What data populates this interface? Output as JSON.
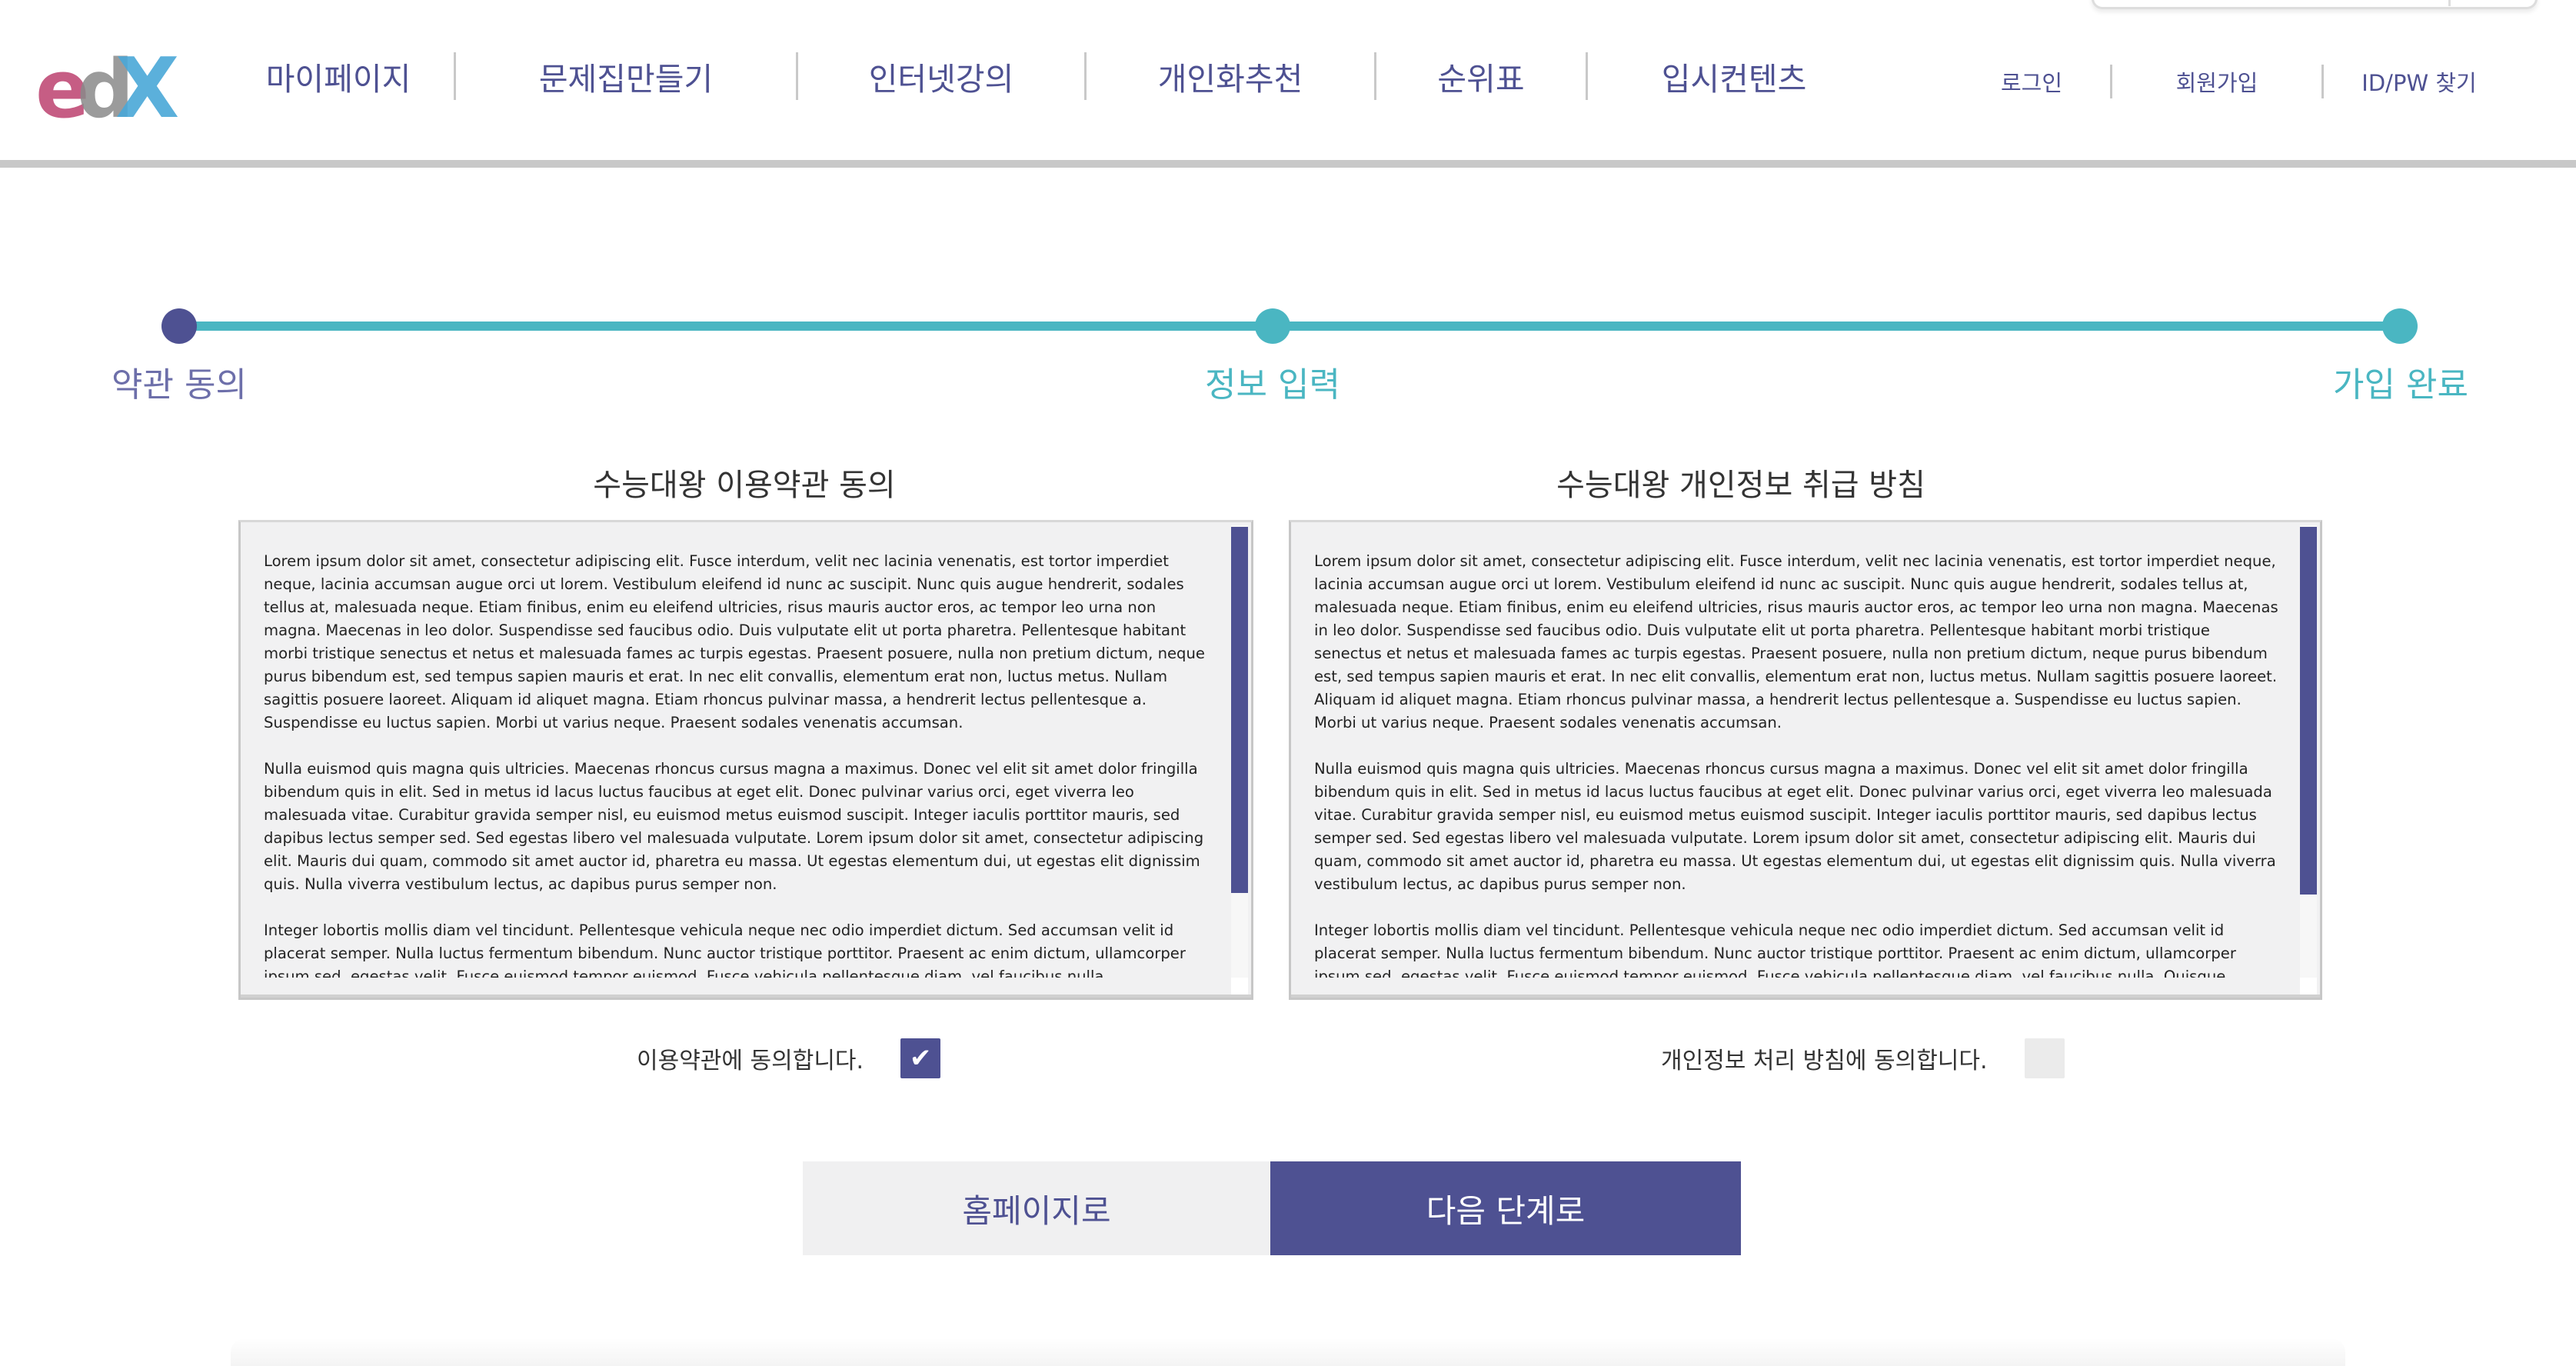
{
  "header": {
    "logo_text": "edX",
    "nav": [
      {
        "label": "마이페이지"
      },
      {
        "label": "문제집만들기"
      },
      {
        "label": "인터넷강의"
      },
      {
        "label": "개인화추천"
      },
      {
        "label": "순위표"
      },
      {
        "label": "입시컨텐츠"
      }
    ],
    "auth": [
      {
        "label": "로그인"
      },
      {
        "label": "회원가입"
      },
      {
        "label": "ID/PW 찾기"
      }
    ]
  },
  "stepper": {
    "steps": [
      {
        "label": "약관 동의",
        "state": "active"
      },
      {
        "label": "정보 입력",
        "state": "todo"
      },
      {
        "label": "가입 완료",
        "state": "todo"
      }
    ],
    "colors": {
      "active": "#4e5192",
      "todo": "#4ab6c2"
    }
  },
  "terms": {
    "title": "수능대왕 이용약관 동의",
    "paragraphs": [
      "Lorem ipsum dolor sit amet, consectetur adipiscing elit. Fusce interdum, velit nec lacinia venenatis, est tortor imperdiet neque, lacinia accumsan augue orci ut lorem. Vestibulum eleifend id nunc ac suscipit. Nunc quis augue hendrerit, sodales tellus at, malesuada neque. Etiam finibus, enim eu eleifend ultricies, risus mauris auctor eros, ac tempor leo urna non magna. Maecenas in leo dolor. Suspendisse sed faucibus odio. Duis vulputate elit ut porta pharetra. Pellentesque habitant morbi tristique senectus et netus et malesuada fames ac turpis egestas. Praesent posuere, nulla non pretium dictum, neque purus bibendum est, sed tempus sapien mauris et erat. In nec elit convallis, elementum erat non, luctus metus. Nullam sagittis posuere laoreet. Aliquam id aliquet magna. Etiam rhoncus pulvinar massa, a hendrerit lectus pellentesque a. Suspendisse eu luctus sapien. Morbi ut varius neque. Praesent sodales venenatis accumsan.",
      "Nulla euismod quis magna quis ultricies. Maecenas rhoncus cursus magna a maximus. Donec vel elit sit amet dolor fringilla bibendum quis in elit. Sed in metus id lacus luctus faucibus at eget elit. Donec pulvinar varius orci, eget viverra leo malesuada vitae. Curabitur gravida semper nisl, eu euismod metus euismod suscipit. Integer iaculis porttitor mauris, sed dapibus lectus semper sed. Sed egestas libero vel malesuada vulputate. Lorem ipsum dolor sit amet, consectetur adipiscing elit. Mauris dui quam, commodo sit amet auctor id, pharetra eu massa. Ut egestas elementum dui, ut egestas elit dignissim quis. Nulla viverra vestibulum lectus, ac dapibus purus semper non.",
      "Integer lobortis mollis diam vel tincidunt. Pellentesque vehicula neque nec odio imperdiet dictum. Sed accumsan velit id placerat semper. Nulla luctus fermentum bibendum. Nunc auctor tristique porttitor. Praesent ac enim dictum, ullamcorper ipsum sed, egestas velit. Fusce euismod tempor euismod. Fusce vehicula pellentesque diam, vel faucibus nulla."
    ],
    "agree_label": "이용약관에 동의합니다.",
    "agreed": true,
    "check_glyph": "✔"
  },
  "privacy": {
    "title": "수능대왕 개인정보 취급 방침",
    "paragraphs": [
      "Lorem ipsum dolor sit amet, consectetur adipiscing elit. Fusce interdum, velit nec lacinia venenatis, est tortor imperdiet neque, lacinia accumsan augue orci ut lorem. Vestibulum eleifend id nunc ac suscipit. Nunc quis augue hendrerit, sodales tellus at, malesuada neque. Etiam finibus, enim eu eleifend ultricies, risus mauris auctor eros, ac tempor leo urna non magna. Maecenas in leo dolor. Suspendisse sed faucibus odio. Duis vulputate elit ut porta pharetra. Pellentesque habitant morbi tristique senectus et netus et malesuada fames ac turpis egestas. Praesent posuere, nulla non pretium dictum, neque purus bibendum est, sed tempus sapien mauris et erat. In nec elit convallis, elementum erat non, luctus metus. Nullam sagittis posuere laoreet. Aliquam id aliquet magna. Etiam rhoncus pulvinar massa, a hendrerit lectus pellentesque a. Suspendisse eu luctus sapien. Morbi ut varius neque. Praesent sodales venenatis accumsan.",
      "Nulla euismod quis magna quis ultricies. Maecenas rhoncus cursus magna a maximus. Donec vel elit sit amet dolor fringilla bibendum quis in elit. Sed in metus id lacus luctus faucibus at eget elit. Donec pulvinar varius orci, eget viverra leo malesuada vitae. Curabitur gravida semper nisl, eu euismod metus euismod suscipit. Integer iaculis porttitor mauris, sed dapibus lectus semper sed. Sed egestas libero vel malesuada vulputate. Lorem ipsum dolor sit amet, consectetur adipiscing elit. Mauris dui quam, commodo sit amet auctor id, pharetra eu massa. Ut egestas elementum dui, ut egestas elit dignissim quis. Nulla viverra vestibulum lectus, ac dapibus purus semper non.",
      "Integer lobortis mollis diam vel tincidunt. Pellentesque vehicula neque nec odio imperdiet dictum. Sed accumsan velit id placerat semper. Nulla luctus fermentum bibendum. Nunc auctor tristique porttitor. Praesent ac enim dictum, ullamcorper ipsum sed, egestas velit. Fusce euismod tempor euismod. Fusce vehicula pellentesque diam, vel faucibus nulla. Quisque"
    ],
    "agree_label": "개인정보 처리 방침에 동의합니다.",
    "agreed": false
  },
  "actions": {
    "home_label": "홈페이지로",
    "next_label": "다음 단계로"
  },
  "colors": {
    "brand": "#4e5192",
    "accent": "#4ab6c2",
    "logo_e": "#c2507a",
    "logo_d": "#8a8a8a",
    "logo_x": "#4aa8d8"
  }
}
